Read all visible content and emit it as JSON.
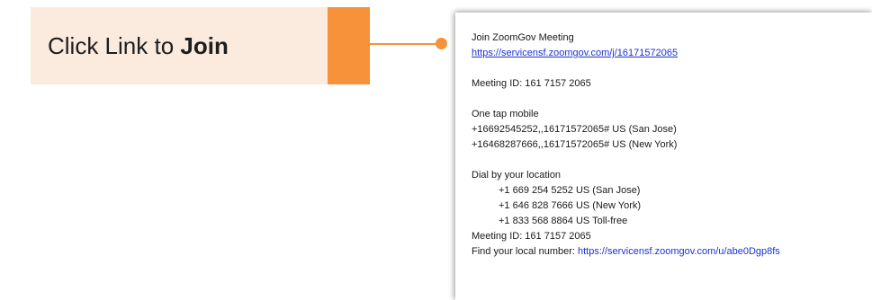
{
  "callout": {
    "label_prefix": "Click Link to ",
    "label_bold": "Join"
  },
  "colors": {
    "accent": "#f7923a",
    "callout_bg": "#fbeade",
    "link": "#1a33d6"
  },
  "email": {
    "heading": "Join ZoomGov Meeting",
    "join_url": "https://servicensf.zoomgov.com/j/16171572065",
    "meeting_id": "Meeting ID: 161 7157 2065",
    "one_tap_heading": "One tap mobile",
    "one_tap": [
      "+16692545252,,16171572065# US (San Jose)",
      "+16468287666,,16171572065# US (New York)"
    ],
    "dial_heading": "Dial by your location",
    "dial_numbers": [
      "+1 669 254 5252 US (San Jose)",
      "+1 646 828 7666 US (New York)",
      "+1 833 568 8864 US Toll-free"
    ],
    "meeting_id_repeat": "Meeting ID: 161 7157 2065",
    "local_number_label": "Find your local number: ",
    "local_number_url": "https://servicensf.zoomgov.com/u/abe0Dgp8fs"
  }
}
